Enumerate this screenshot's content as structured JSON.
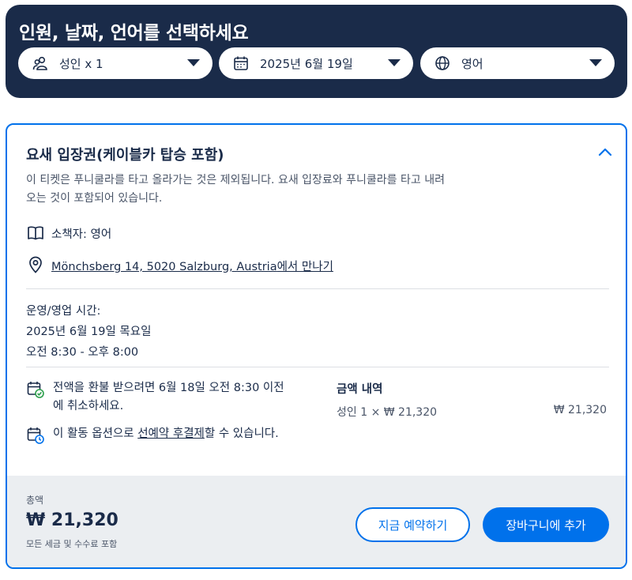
{
  "header": {
    "title": "인원, 날짜, 언어를 선택하세요",
    "participants": {
      "icon": "people-icon",
      "label": "성인 x 1"
    },
    "date": {
      "icon": "calendar-icon",
      "label": "2025년 6월 19일"
    },
    "language": {
      "icon": "globe-icon",
      "label": "영어"
    }
  },
  "option": {
    "title": "요새 입장권(케이블카 탑승 포함)",
    "description": "이 티켓은 푸니쿨라를 타고 올라가는 것은 제외됩니다. 요새 입장료와 푸니쿨라를 타고 내려오는 것이 포함되어 있습니다.",
    "booklet": "소책자: 영어",
    "meeting_address": "Mönchsberg 14, 5020 Salzburg, Austria",
    "meeting_suffix": "에서 만나기",
    "hours_label": "운영/영업 시간:",
    "hours_date": "2025년 6월 19일 목요일",
    "hours_time": "오전 8:30 - 오후 8:00",
    "refund_text": "전액을 환불 받으려면 6월 18일 오전 8:30 이전에 취소하세요.",
    "reserve_prefix": "이 활동 옵션으로 ",
    "reserve_link": "선예약 후결제",
    "reserve_suffix": "할 수 있습니다.",
    "price_title": "금액 내역",
    "price_line": "성인 1 × ₩ 21,320",
    "price_amount": "₩ 21,320"
  },
  "footer": {
    "total_label": "총액",
    "total_amount": "₩ 21,320",
    "total_note": "모든 세금 및 수수료 포함",
    "book_now_label": "지금 예약하기",
    "add_to_cart_label": "장바구니에 추가"
  },
  "colors": {
    "navy": "#1a2b49",
    "accent": "#0071eb",
    "footer_bg": "#ebeef1",
    "refund_green": "#2b9e4b"
  }
}
